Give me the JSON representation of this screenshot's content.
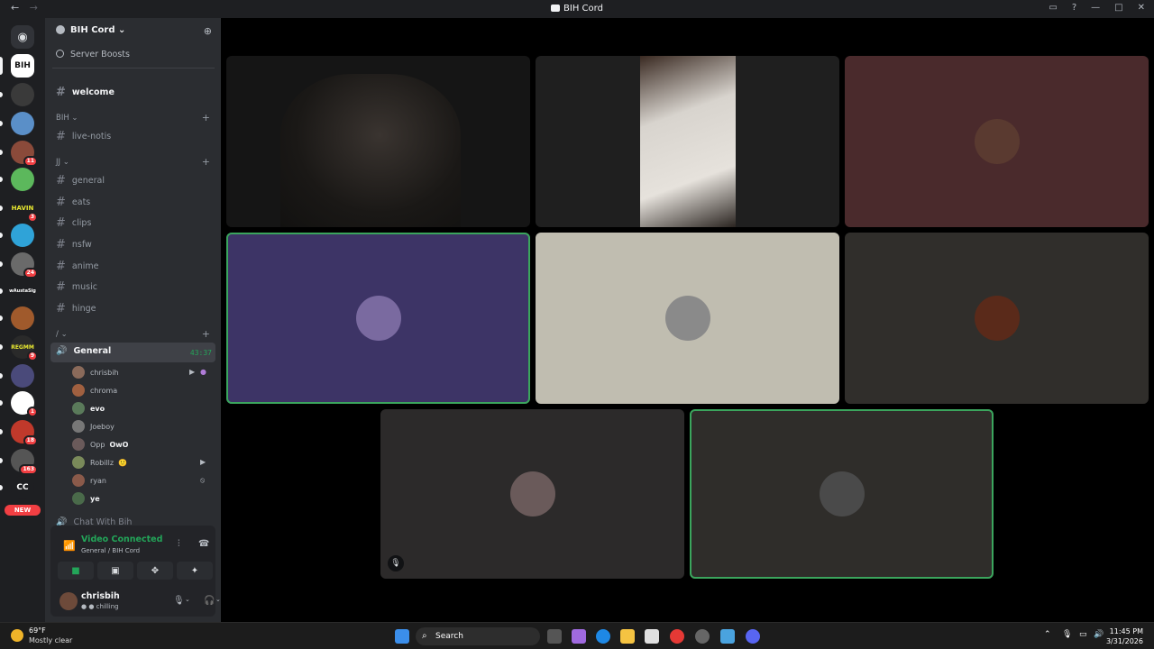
{
  "window": {
    "title": "BIH Cord",
    "back_glyph": "←",
    "forward_glyph": "→"
  },
  "server_rail": {
    "items": [
      {
        "icon": "discord-home-icon",
        "label": "",
        "color": "#313338",
        "badge": ""
      },
      {
        "icon": "server-icon",
        "label": "BIH",
        "color": "#ffffff",
        "badge": ""
      },
      {
        "icon": "server-icon",
        "label": "",
        "color": "#3a3a3a",
        "badge": ""
      },
      {
        "icon": "server-icon",
        "label": "",
        "color": "#5a8fc8",
        "badge": ""
      },
      {
        "icon": "server-icon",
        "label": "",
        "color": "#8a4a3a",
        "badge": "11"
      },
      {
        "icon": "server-icon",
        "label": "",
        "color": "#5cb85c",
        "badge": ""
      },
      {
        "icon": "server-icon",
        "label": "HAVIN",
        "color": "#1e1f22",
        "badge": "3"
      },
      {
        "icon": "server-icon",
        "label": "",
        "color": "#2fa3d8",
        "badge": ""
      },
      {
        "icon": "server-icon",
        "label": "",
        "color": "#6a6a6a",
        "badge": "24"
      },
      {
        "icon": "server-icon",
        "label": "wAustaSig",
        "color": "#1e1f22",
        "badge": ""
      },
      {
        "icon": "server-icon",
        "label": "",
        "color": "#a05a2c",
        "badge": ""
      },
      {
        "icon": "server-icon",
        "label": "REGMM",
        "color": "#2a2a2a",
        "badge": "9"
      },
      {
        "icon": "server-icon",
        "label": "",
        "color": "#4a4a7a",
        "badge": ""
      },
      {
        "icon": "server-icon",
        "label": "",
        "color": "#ffffff",
        "badge": "1"
      },
      {
        "icon": "server-icon",
        "label": "",
        "color": "#c0392b",
        "badge": "18"
      },
      {
        "icon": "server-icon",
        "label": "",
        "color": "#555555",
        "badge": "163"
      },
      {
        "icon": "server-icon",
        "label": "CC",
        "color": "#1e1f22",
        "badge": ""
      },
      {
        "icon": "new-pill",
        "label": "NEW",
        "color": "#f23f43",
        "badge": ""
      }
    ]
  },
  "server": {
    "name": "BIH Cord",
    "boosts_label": "Server Boosts",
    "welcome_channel": "welcome",
    "categories": [
      {
        "name": "BIH",
        "channels": [
          "live-notis"
        ]
      },
      {
        "name": "JJ",
        "channels": [
          "general",
          "eats",
          "clips",
          "nsfw",
          "anime",
          "music",
          "hinge"
        ]
      },
      {
        "name": "/",
        "channels": []
      }
    ],
    "voice_channel": {
      "name": "General",
      "timer": "43:37",
      "users": [
        {
          "name": "chrisbih",
          "color": "#8a6a5a",
          "bold": false,
          "extra": ""
        },
        {
          "name": "chroma",
          "color": "#a06040",
          "bold": false,
          "extra": ""
        },
        {
          "name": "evo",
          "color": "#5a7a5a",
          "bold": true,
          "extra": ""
        },
        {
          "name": "Joeboy",
          "color": "#777777",
          "bold": false,
          "extra": ""
        },
        {
          "name": "Opp",
          "color": "#6a5a5a",
          "bold": false,
          "extra": "OwO"
        },
        {
          "name": "Robillz",
          "color": "#7a8a5a",
          "bold": false,
          "extra": "🙂"
        },
        {
          "name": "ryan",
          "color": "#8a5a4a",
          "bold": false,
          "extra": ""
        },
        {
          "name": "ye",
          "color": "#4a6a4a",
          "bold": true,
          "extra": ""
        }
      ]
    },
    "next_channel": "Chat With Bih"
  },
  "voice_panel": {
    "status": "Video Connected",
    "location": "General / BIH Cord",
    "username": "chrisbih",
    "user_status": "chilling"
  },
  "stage": {
    "tiles": [
      {
        "name": "video-tile-1",
        "bg": "#151515",
        "type": "video",
        "speaking": false,
        "muted": false
      },
      {
        "name": "video-tile-2",
        "bg": "#1f1f1f",
        "type": "video",
        "speaking": false,
        "muted": false
      },
      {
        "name": "avatar-tile-3",
        "bg": "#4a2a2c",
        "type": "avatar",
        "avatar": "#5a3a30",
        "speaking": false,
        "muted": false
      },
      {
        "name": "avatar-tile-4",
        "bg": "#3d3466",
        "type": "avatar",
        "avatar": "#7a6aa0",
        "speaking": true,
        "muted": false
      },
      {
        "name": "avatar-tile-5",
        "bg": "#c0bdb0",
        "type": "avatar",
        "avatar": "#8a8a8a",
        "speaking": false,
        "muted": false
      },
      {
        "name": "avatar-tile-6",
        "bg": "#302e2b",
        "type": "avatar",
        "avatar": "#5a2a1a",
        "speaking": false,
        "muted": false
      },
      {
        "name": "avatar-tile-7",
        "bg": "#2c2a2a",
        "type": "avatar",
        "avatar": "#6a5a5a",
        "speaking": false,
        "muted": true
      },
      {
        "name": "avatar-tile-8",
        "bg": "#2f2d2a",
        "type": "avatar",
        "avatar": "#4a4a4a",
        "speaking": true,
        "muted": false
      }
    ]
  },
  "taskbar": {
    "temperature": "69°F",
    "weather": "Mostly clear",
    "search_placeholder": "Search",
    "time": "11:45 PM",
    "date": "3/31/2026"
  }
}
